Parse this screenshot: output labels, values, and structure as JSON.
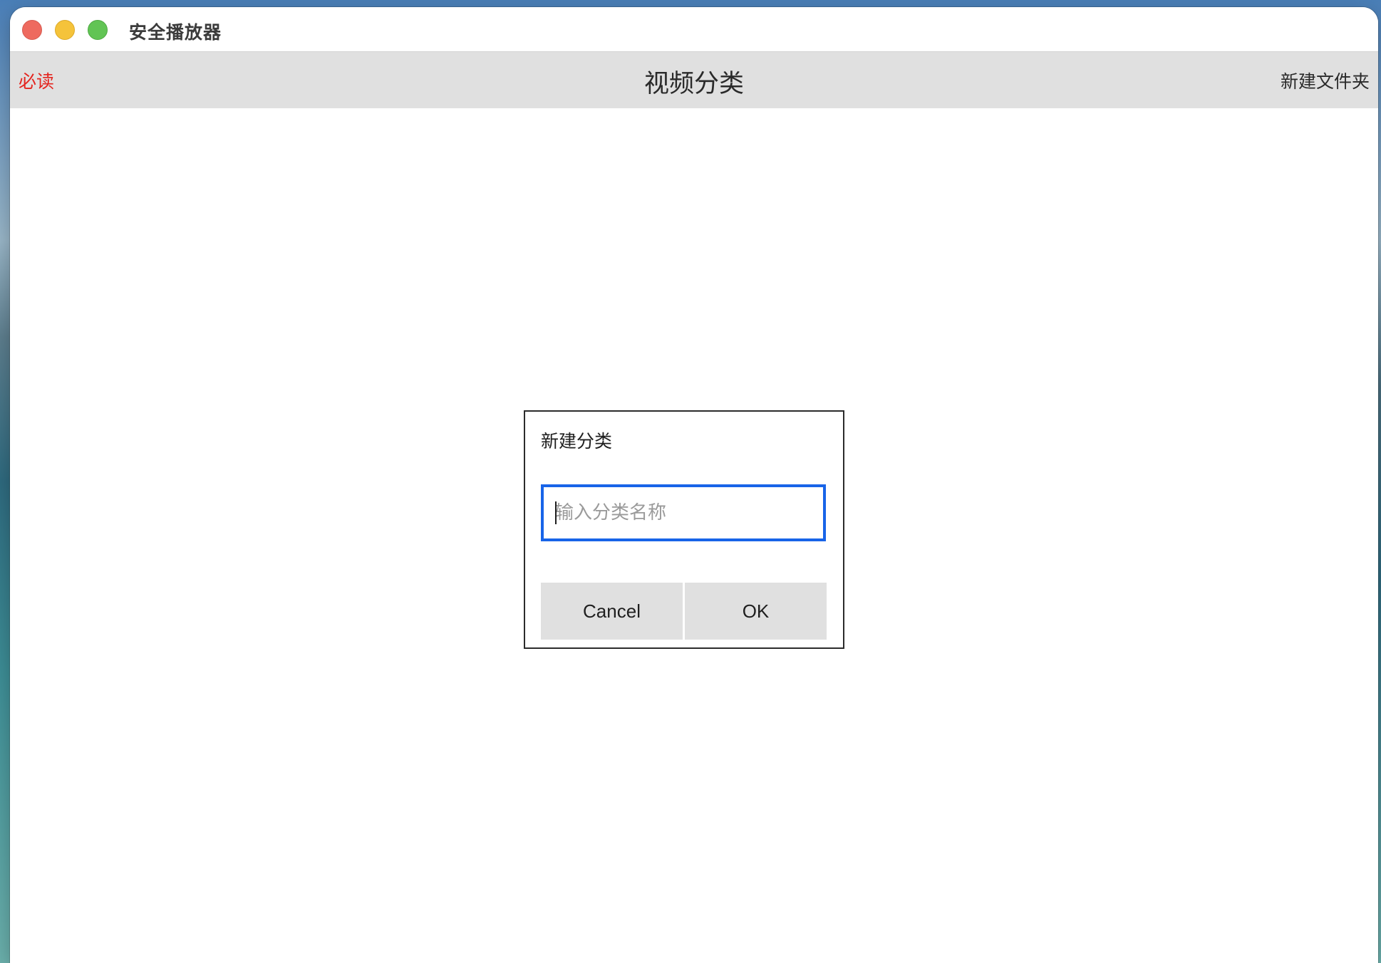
{
  "window": {
    "title": "安全播放器",
    "controls": [
      "close",
      "minimize",
      "zoom"
    ]
  },
  "navbar": {
    "left_label": "必读",
    "title": "视频分类",
    "right_label": "新建文件夹"
  },
  "dialog": {
    "title": "新建分类",
    "input_value": "",
    "input_placeholder": "输入分类名称",
    "cancel_label": "Cancel",
    "ok_label": "OK"
  },
  "colors": {
    "nav_left_text": "#e4251f",
    "navbar_bg": "#e0e0e0",
    "input_focus_border": "#1864e8",
    "close": "#ee6a5f",
    "minimize": "#f5c33a",
    "zoom": "#61c454"
  }
}
